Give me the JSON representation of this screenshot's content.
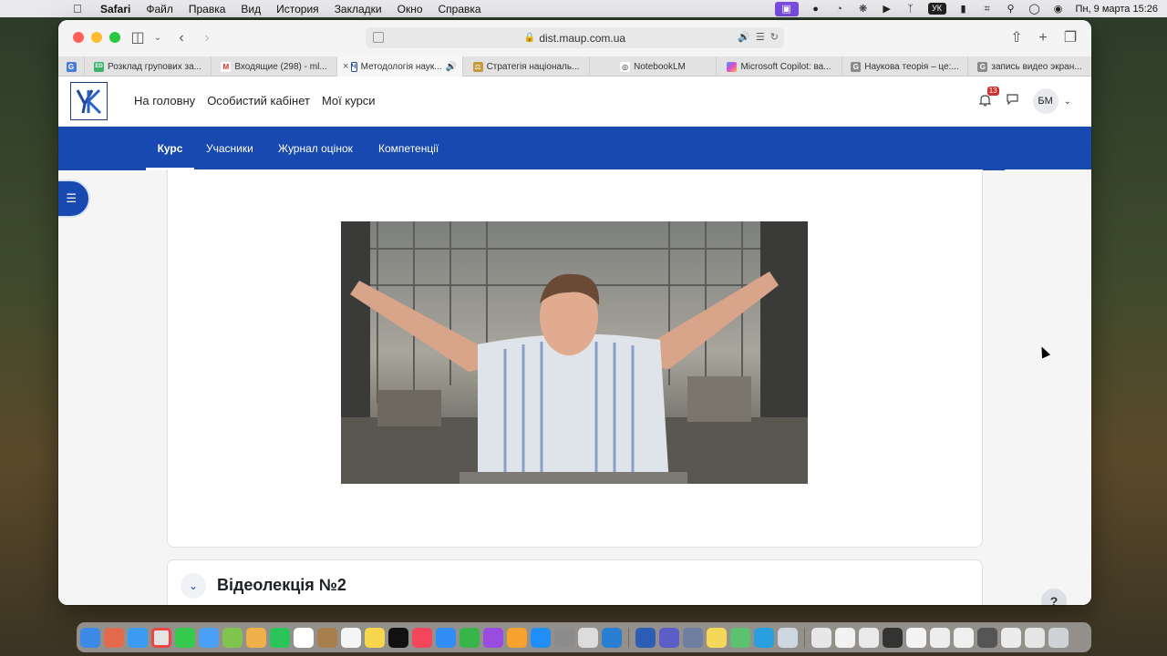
{
  "menubar": {
    "app_name": "Safari",
    "items": [
      "Файл",
      "Правка",
      "Вид",
      "История",
      "Закладки",
      "Окно",
      "Справка"
    ],
    "keyboard_layout": "УК",
    "datetime": "Пн, 9 марта  15:26"
  },
  "browser": {
    "url": "dist.maup.com.ua",
    "tabs": [
      {
        "label": "Розклад групових за...",
        "favicon_color": "#3bb36a",
        "favicon_text": "ED"
      },
      {
        "label": "Входящие (298) - ml...",
        "favicon_color": "#d93025",
        "favicon_text": "M"
      },
      {
        "label": "Методологія наук...",
        "favicon_color": "#1f4a9a",
        "favicon_text": "Ч"
      },
      {
        "label": "Стратегія національ...",
        "favicon_color": "#8a6d3b",
        "favicon_text": "⚖"
      },
      {
        "label": "NotebookLM",
        "favicon_color": "#222222",
        "favicon_text": "◎"
      },
      {
        "label": "Microsoft Copilot: ва...",
        "favicon_color": "#5b8def",
        "favicon_text": "✦"
      },
      {
        "label": "Наукова теорія – це:...",
        "favicon_color": "#777777",
        "favicon_text": "G"
      },
      {
        "label": "запись видео экран...",
        "favicon_color": "#777777",
        "favicon_text": "G"
      }
    ]
  },
  "site": {
    "logo_text": "ЧК",
    "nav": [
      "На головну",
      "Особистий кабінет",
      "Мої курси"
    ],
    "notifications_count": "13",
    "user_initials": "БМ"
  },
  "course_nav": {
    "items": [
      "Курс",
      "Учасники",
      "Журнал оцінок",
      "Компетенції"
    ],
    "active": "Курс"
  },
  "section": {
    "title": "Відеолекція №2"
  },
  "help_label": "?"
}
